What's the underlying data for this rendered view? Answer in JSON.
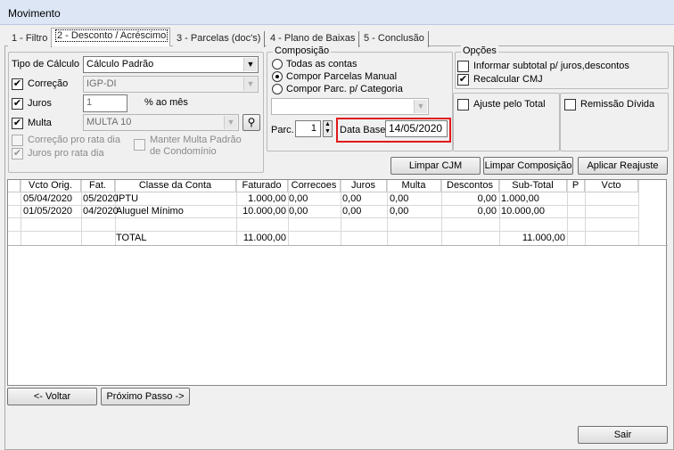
{
  "window": {
    "title": "Movimento"
  },
  "tabs": [
    {
      "label": "1 - Filtro"
    },
    {
      "label": "2 - Desconto / Acréscimo"
    },
    {
      "label": "3 - Parcelas (doc's)"
    },
    {
      "label": "4 - Plano de Baixas"
    },
    {
      "label": "5 - Conclusão"
    }
  ],
  "calc": {
    "tipo_label": "Tipo de Cálculo",
    "tipo_value": "Cálculo Padrão",
    "correcao_label": "Correção",
    "correcao_value": "IGP-DI",
    "juros_label": "Juros",
    "juros_value": "1",
    "juros_unit": "% ao mês",
    "multa_label": "Multa",
    "multa_value": "MULTA 10",
    "correcao_rata": "Correção pro rata dia",
    "juros_rata": "Juros pro rata dia",
    "manter_multa": "Manter Multa Padrão de Condomínio"
  },
  "composicao": {
    "title": "Composição",
    "opt1": "Todas as contas",
    "opt2": "Compor Parcelas Manual",
    "opt3": "Compor Parc. p/ Categoria",
    "parc_label": "Parc.",
    "parc_value": "1",
    "data_base_label": "Data Base",
    "data_base_value": "14/05/2020"
  },
  "opcoes": {
    "title": "Opções",
    "informar": "Informar subtotal p/ juros,descontos",
    "recalcular": "Recalcular CMJ",
    "ajuste": "Ajuste pelo Total",
    "remissao": "Remissão Dívida"
  },
  "buttons": {
    "limpar_cjm": "Limpar CJM",
    "limpar_comp": "Limpar Composição",
    "aplicar": "Aplicar Reajuste",
    "voltar": "<- Voltar",
    "proximo": "Próximo Passo ->",
    "sair": "Sair"
  },
  "table": {
    "headers": [
      "Vcto Orig.",
      "Fat.",
      "Classe da Conta",
      "Faturado",
      "Correcoes",
      "Juros",
      "Multa",
      "Descontos",
      "Sub-Total",
      "P",
      "Vcto"
    ],
    "rows": [
      [
        "05/04/2020",
        "05/2020",
        "IPTU",
        "1.000,00",
        "0,00",
        "0,00",
        "0,00",
        "0,00",
        "1.000,00",
        "",
        ""
      ],
      [
        "01/05/2020",
        "04/2020",
        "Aluguel Mínimo",
        "10.000,00",
        "0,00",
        "0,00",
        "0,00",
        "0,00",
        "10.000,00",
        "",
        ""
      ]
    ],
    "total_label": "TOTAL",
    "total_faturado": "11.000,00",
    "total_subtotal": "11.000,00"
  }
}
